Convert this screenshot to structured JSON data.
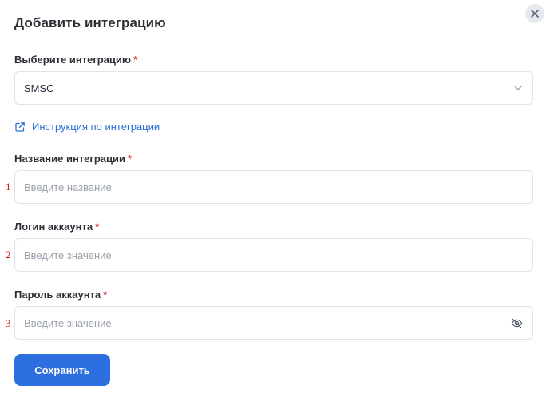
{
  "modal": {
    "title": "Добавить интеграцию",
    "close_icon": "close-icon"
  },
  "integration_select": {
    "label": "Выберите интеграцию",
    "required_mark": "*",
    "selected_value": "SMSC",
    "icon": "chevron-down-icon"
  },
  "instruction_link": {
    "label": "Инструкция по интеграции",
    "icon": "external-link-icon"
  },
  "fields": [
    {
      "label": "Название интеграции",
      "required_mark": "*",
      "placeholder": "Введите название",
      "marker": "1"
    },
    {
      "label": "Логин аккаунта",
      "required_mark": "*",
      "placeholder": "Введите значение",
      "marker": "2"
    },
    {
      "label": "Пароль аккаунта",
      "required_mark": "*",
      "placeholder": "Введите значение",
      "marker": "3",
      "icon": "eye-off-icon"
    }
  ],
  "save_button": {
    "label": "Сохранить"
  },
  "colors": {
    "accent": "#2d6fdf",
    "link": "#2b6fd6",
    "required": "#e5484d",
    "marker": "#d0191f"
  }
}
